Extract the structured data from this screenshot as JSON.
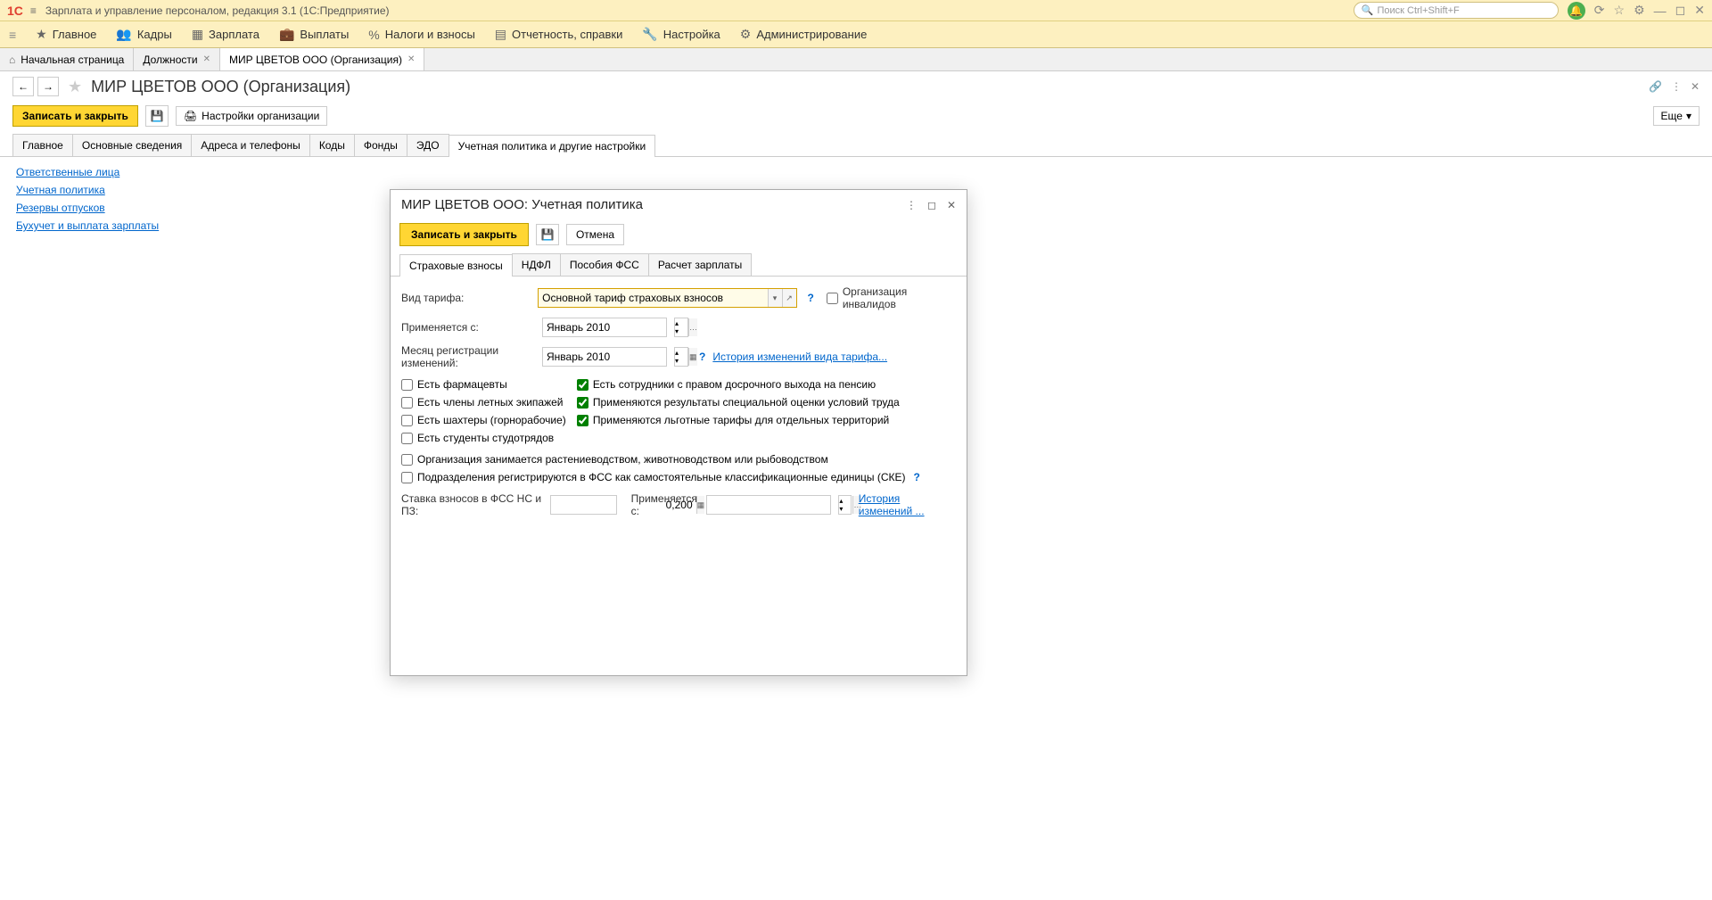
{
  "titlebar": {
    "app_title": "Зарплата и управление персоналом, редакция 3.1  (1С:Предприятие)",
    "search_placeholder": "Поиск Ctrl+Shift+F"
  },
  "menu": {
    "items": [
      {
        "label": "Главное"
      },
      {
        "label": "Кадры"
      },
      {
        "label": "Зарплата"
      },
      {
        "label": "Выплаты"
      },
      {
        "label": "Налоги и взносы"
      },
      {
        "label": "Отчетность, справки"
      },
      {
        "label": "Настройка"
      },
      {
        "label": "Администрирование"
      }
    ]
  },
  "tabs": {
    "home": "Начальная страница",
    "t1": "Должности",
    "t2": "МИР ЦВЕТОВ ООО (Организация)"
  },
  "page": {
    "title": "МИР ЦВЕТОВ ООО (Организация)"
  },
  "toolbar": {
    "save_close": "Записать и закрыть",
    "print_settings": "Настройки организации",
    "more": "Еще"
  },
  "form_tabs": [
    "Главное",
    "Основные сведения",
    "Адреса и телефоны",
    "Коды",
    "Фонды",
    "ЭДО",
    "Учетная политика и другие настройки"
  ],
  "links": [
    "Ответственные лица",
    "Учетная политика",
    "Резервы отпусков",
    "Бухучет и выплата зарплаты"
  ],
  "modal": {
    "title": "МИР ЦВЕТОВ ООО: Учетная политика",
    "save_close": "Записать и закрыть",
    "cancel": "Отмена",
    "tabs": [
      "Страховые взносы",
      "НДФЛ",
      "Пособия ФСС",
      "Расчет зарплаты"
    ],
    "fields": {
      "tariff_label": "Вид тарифа:",
      "tariff_value": "Основной тариф страховых взносов",
      "org_invalid": "Организация инвалидов",
      "applies_from_label": "Применяется с:",
      "applies_from_value": "Январь 2010",
      "reg_month_label": "Месяц регистрации изменений:",
      "reg_month_value": "Январь 2010",
      "history_link": "История изменений вида тарифа...",
      "chk_pharm": "Есть фармацевты",
      "chk_flight": "Есть члены летных экипажей",
      "chk_miners": "Есть шахтеры (горнорабочие)",
      "chk_students": "Есть студенты студотрядов",
      "chk_early": "Есть сотрудники с правом досрочного выхода на пенсию",
      "chk_special": "Применяются результаты специальной оценки условий труда",
      "chk_pref": "Применяются льготные тарифы для отдельных территорий",
      "chk_agro": "Организация занимается растениеводством, животноводством или рыбоводством",
      "chk_fss": "Подразделения регистрируются в ФСС как самостоятельные классификационные единицы (СКЕ)",
      "rate_label": "Ставка взносов в ФСС НС и ПЗ:",
      "rate_value": "0,200",
      "applies_from2_label": "Применяется с:",
      "applies_from2_value": "",
      "history2": "История изменений ..."
    }
  }
}
